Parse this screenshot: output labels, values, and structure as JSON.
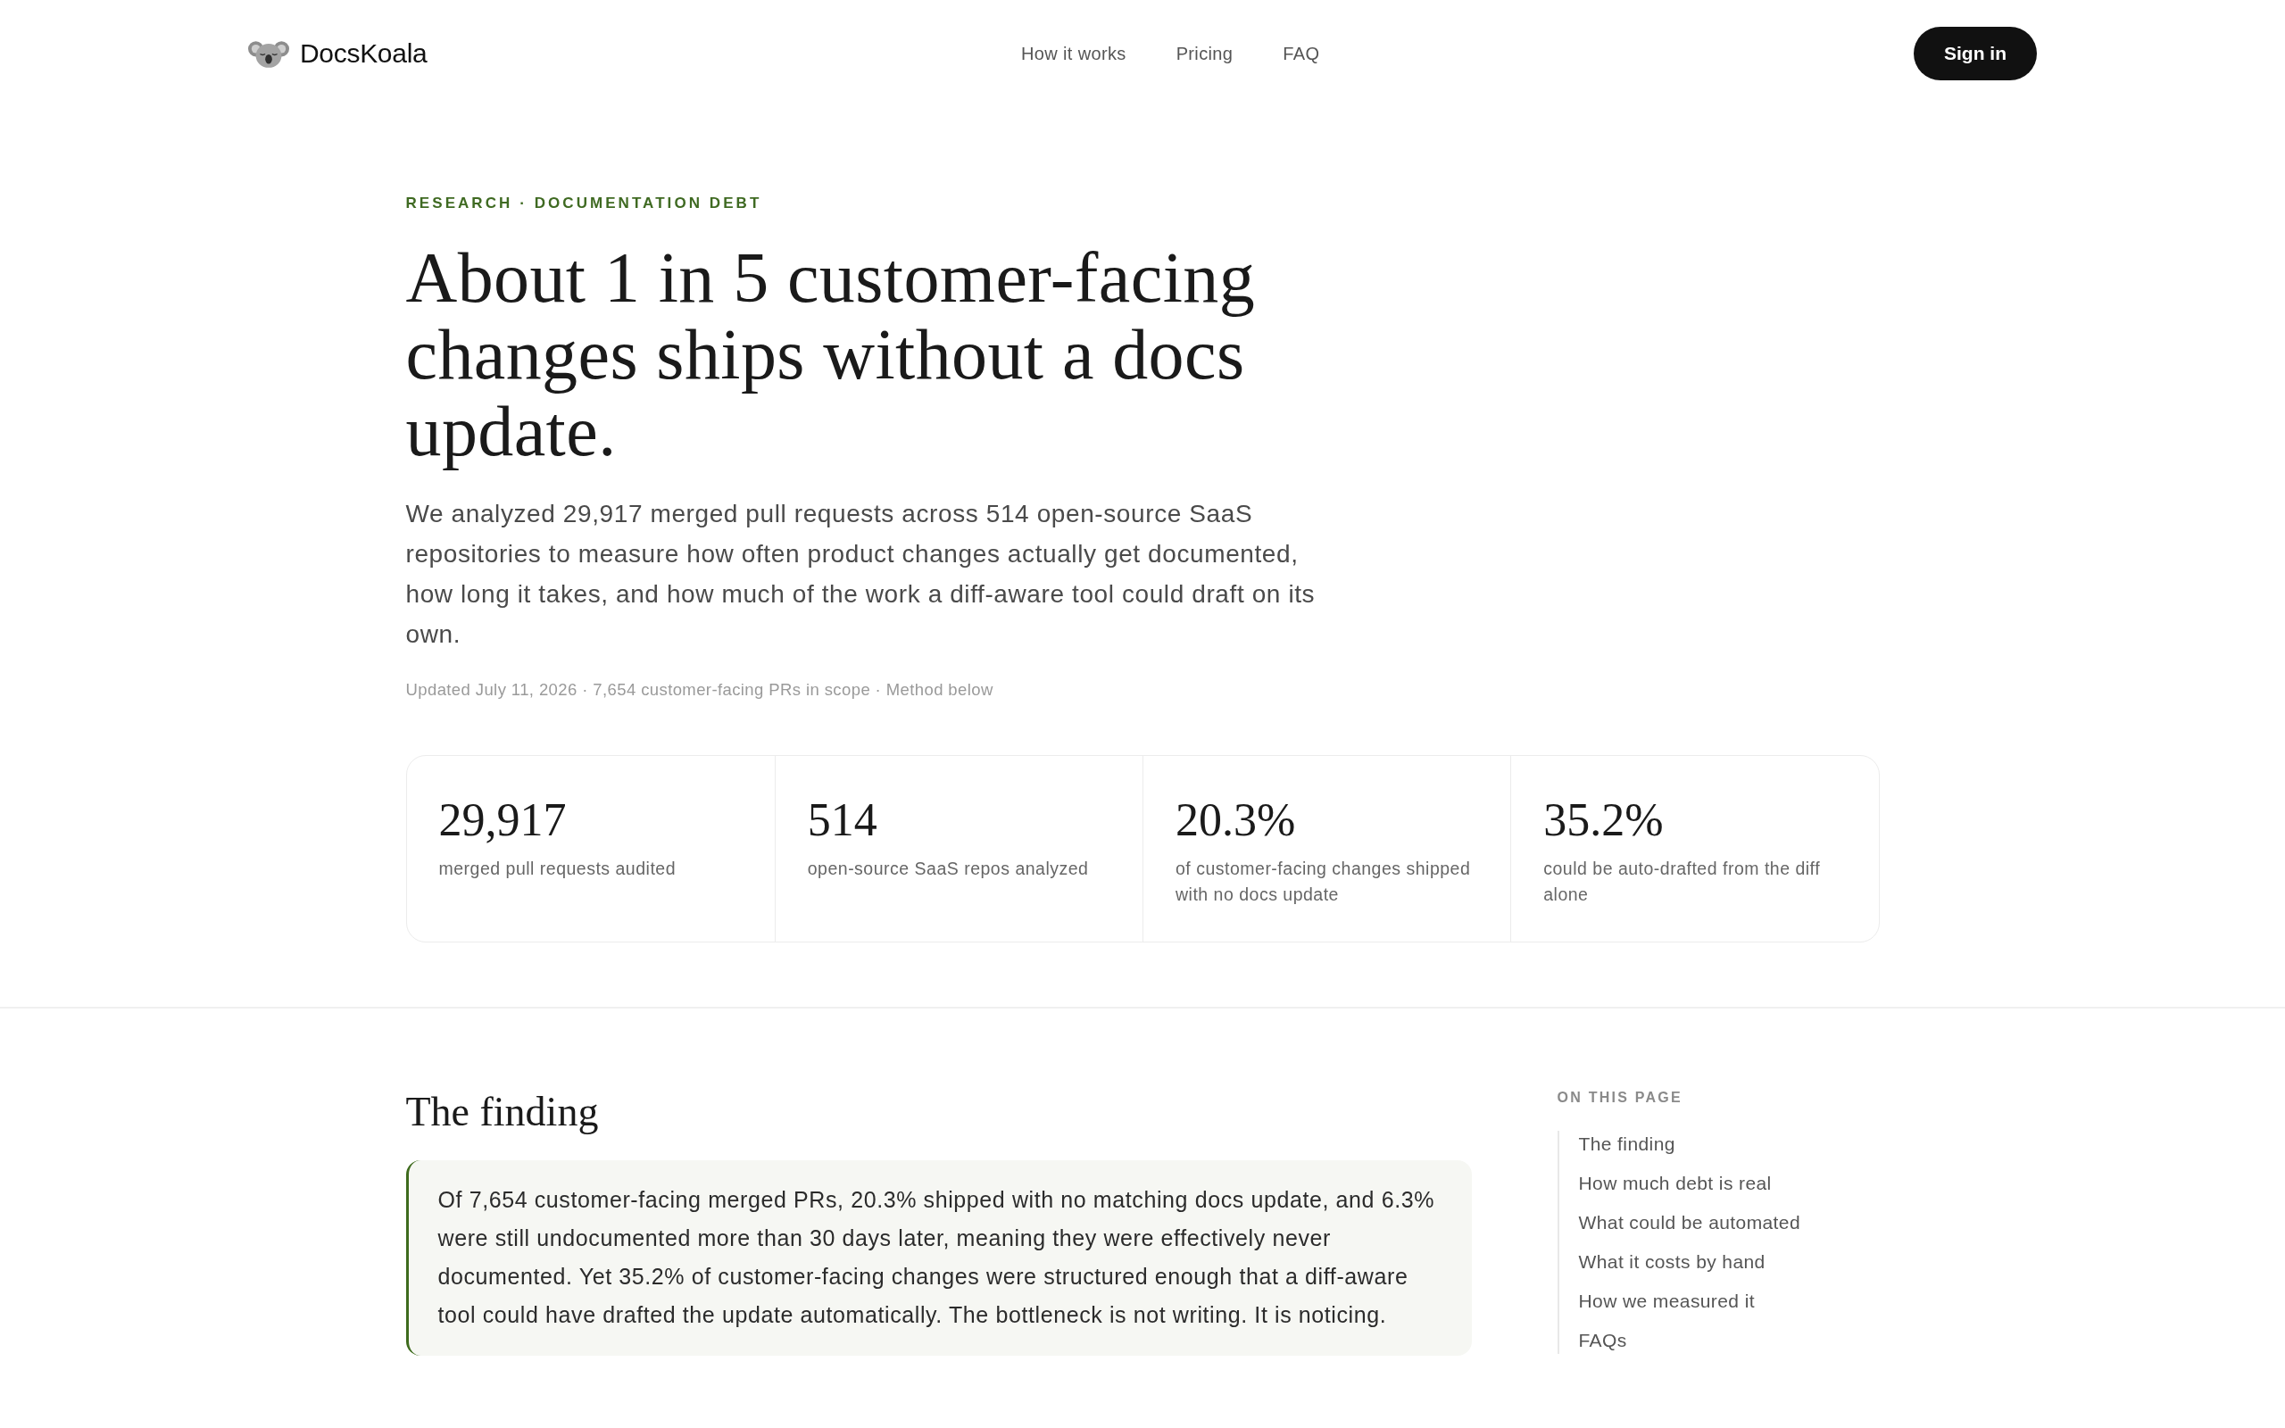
{
  "header": {
    "logo": "DocsKoala",
    "nav": [
      "How it works",
      "Pricing",
      "FAQ"
    ],
    "sign_in": "Sign in"
  },
  "hero": {
    "eyebrow": "RESEARCH · DOCUMENTATION DEBT",
    "title": "About 1 in 5 customer-facing changes ships without a docs update.",
    "intro": "We analyzed 29,917 merged pull requests across 514 open-source SaaS repositories to measure how often product changes actually get documented, how long it takes, and how much of the work a diff-aware tool could draft on its own.",
    "meta": "Updated July 11, 2026 · 7,654 customer-facing PRs in scope · Method below"
  },
  "stats": [
    {
      "value": "29,917",
      "label": "merged pull requests audited"
    },
    {
      "value": "514",
      "label": "open-source SaaS repos analyzed"
    },
    {
      "value": "20.3%",
      "label": "of customer-facing changes shipped with no docs update"
    },
    {
      "value": "35.2%",
      "label": "could be auto-drafted from the diff alone"
    }
  ],
  "finding": {
    "heading": "The finding",
    "callout": "Of 7,654 customer-facing merged PRs, 20.3% shipped with no matching docs update, and 6.3% were still undocumented more than 30 days later, meaning they were effectively never documented. Yet 35.2% of customer-facing changes were structured enough that a diff-aware tool could have drafted the update automatically. The bottleneck is not writing. It is noticing."
  },
  "toc": {
    "title": "ON THIS PAGE",
    "items": [
      "The finding",
      "How much debt is real",
      "What could be automated",
      "What it costs by hand",
      "How we measured it",
      "FAQs"
    ]
  }
}
